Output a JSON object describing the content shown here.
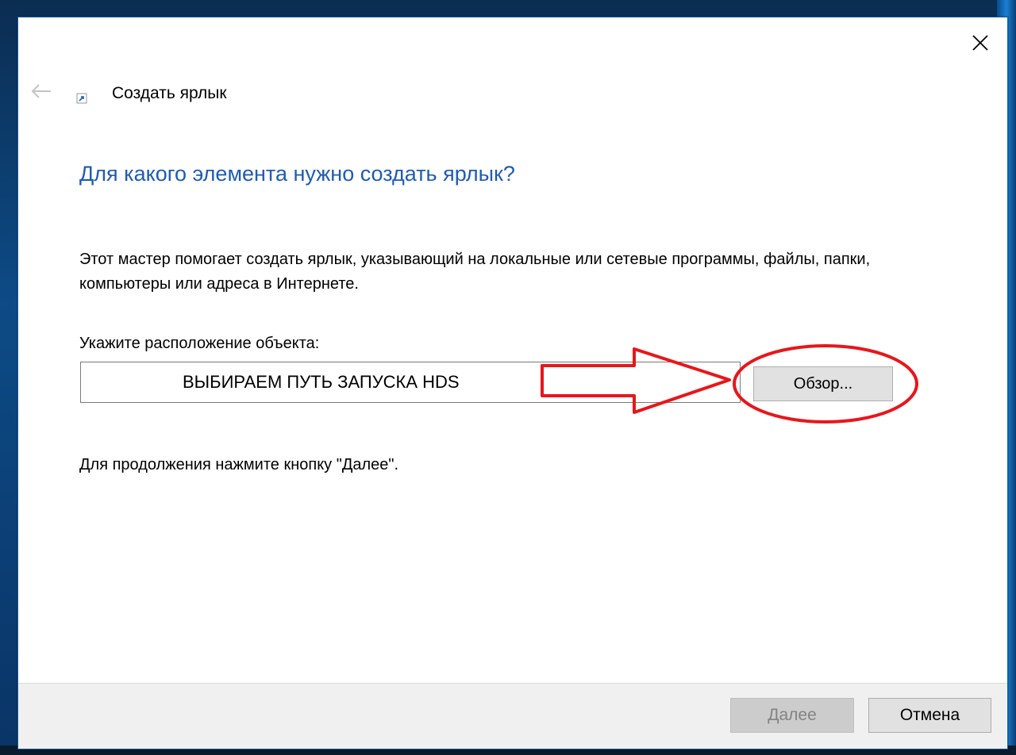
{
  "window": {
    "title": "Создать ярлык",
    "heading": "Для какого элемента нужно создать ярлык?",
    "description": "Этот мастер помогает создать ярлык, указывающий на локальные или сетевые программы, файлы, папки, компьютеры или адреса в Интернете.",
    "location_label": "Укажите расположение объекта:",
    "location_value": "ВЫБИРАЕМ ПУТЬ ЗАПУСКА HDS",
    "browse_label": "Обзор...",
    "continue_hint": "Для продолжения нажмите кнопку \"Далее\"."
  },
  "footer": {
    "next_label": "Далее",
    "cancel_label": "Отмена"
  },
  "icons": {
    "close": "close-icon",
    "back": "back-arrow-icon",
    "shortcut": "shortcut-icon"
  },
  "colors": {
    "heading": "#1f5bb5",
    "annotation": "#e8161b",
    "footer_bg": "#f0f0f0"
  }
}
